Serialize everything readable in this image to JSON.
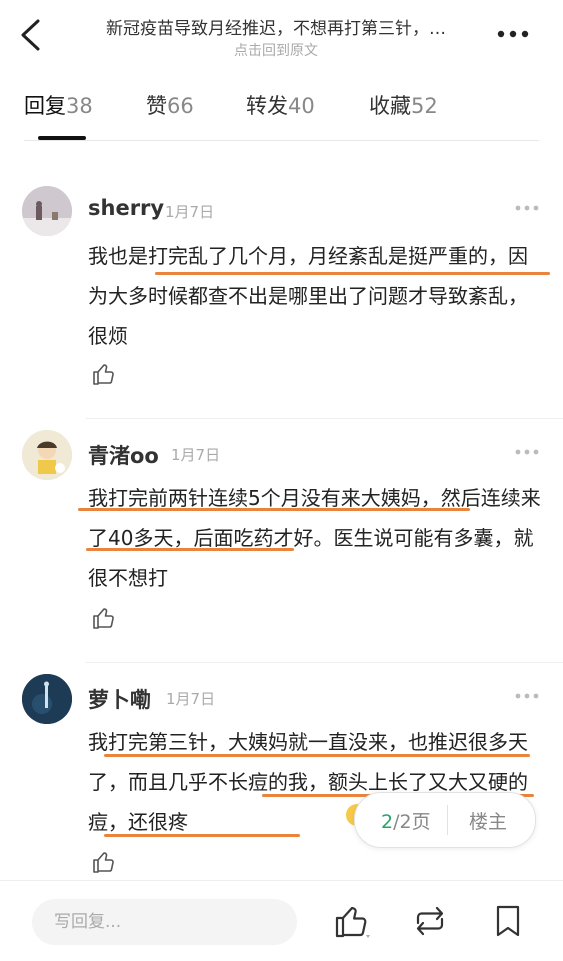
{
  "header": {
    "title": "新冠疫苗导致月经推迟，不想再打第三针，…",
    "subtitle": "点击回到原文",
    "back_icon": "chevron-left-icon",
    "more_icon": "more-dots-icon"
  },
  "tabs": [
    {
      "label": "回复",
      "count": "38"
    },
    {
      "label": "赞",
      "count": "66"
    },
    {
      "label": "转发",
      "count": "40"
    },
    {
      "label": "收藏",
      "count": "52"
    }
  ],
  "comments": [
    {
      "name": "sherry",
      "date": "1月7日",
      "text": "我也是打完乱了几个月，月经紊乱是挺严重的，因为大多时候都查不出是哪里出了问题才导致紊乱，很烦"
    },
    {
      "name": "青渚oo",
      "date": "1月7日",
      "text": "我打完前两针连续5个月没有来大姨妈，然后连续来了40多天，后面吃药才好。医生说可能有多囊，就很不想打"
    },
    {
      "name": "萝卜嘞",
      "date": "1月7日",
      "text": "我打完第三针，大姨妈就一直没来，也推迟很多天了，而且几乎不长痘的我，额头上长了又大又硬的痘，还很疼"
    }
  ],
  "pager": {
    "current": "2",
    "total": "/2页",
    "owner_label": "楼主"
  },
  "bottom": {
    "reply_placeholder": "写回复..."
  },
  "colors": {
    "highlight": "#e9843c",
    "accent_green": "#2aa36a"
  }
}
